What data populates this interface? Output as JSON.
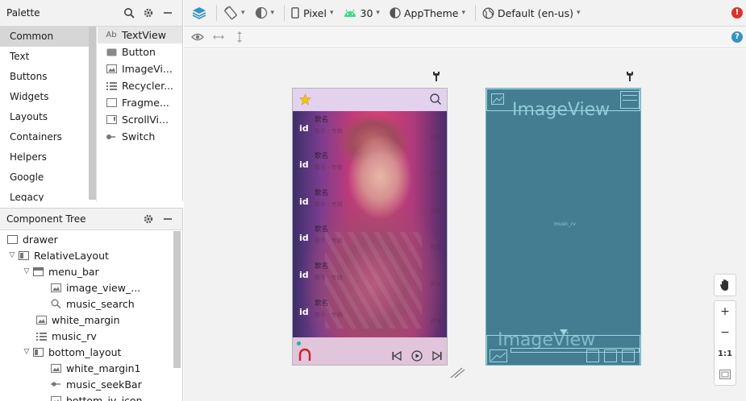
{
  "palette": {
    "title": "Palette",
    "categories": [
      "Common",
      "Text",
      "Buttons",
      "Widgets",
      "Layouts",
      "Containers",
      "Helpers",
      "Google",
      "Legacy"
    ],
    "selected_category": "Common",
    "items": [
      {
        "icon_text": "Ab",
        "label": "TextView",
        "icon": "textview-icon"
      },
      {
        "icon_text": "",
        "label": "Button",
        "icon": "button-icon"
      },
      {
        "icon_text": "",
        "label": "ImageVi...",
        "icon": "image-icon"
      },
      {
        "icon_text": "",
        "label": "Recycler...",
        "icon": "list-icon"
      },
      {
        "icon_text": "",
        "label": "Fragme...",
        "icon": "fragment-icon"
      },
      {
        "icon_text": "",
        "label": "ScrollVi...",
        "icon": "scrollview-icon"
      },
      {
        "icon_text": "",
        "label": "Switch",
        "icon": "switch-icon"
      }
    ]
  },
  "component_tree": {
    "title": "Component Tree",
    "nodes": [
      {
        "label": "drawer",
        "depth": 0,
        "arrow": "",
        "icon": "layout-icon"
      },
      {
        "label": "RelativeLayout",
        "depth": 0,
        "arrow": "v",
        "icon": "relativelayout-icon"
      },
      {
        "label": "menu_bar",
        "depth": 1,
        "arrow": "v",
        "icon": "toolbar-icon"
      },
      {
        "label": "image_view_...",
        "depth": 2,
        "arrow": "",
        "icon": "image-icon"
      },
      {
        "label": "music_search",
        "depth": 2,
        "arrow": "",
        "icon": "search-icon"
      },
      {
        "label": "white_margin",
        "depth": 1,
        "arrow": "",
        "icon": "image-icon"
      },
      {
        "label": "music_rv",
        "depth": 1,
        "arrow": "",
        "icon": "list-icon"
      },
      {
        "label": "bottom_layout",
        "depth": 1,
        "arrow": "v",
        "icon": "relativelayout-icon"
      },
      {
        "label": "white_margin1",
        "depth": 2,
        "arrow": "",
        "icon": "image-icon"
      },
      {
        "label": "music_seekBar",
        "depth": 2,
        "arrow": "",
        "icon": "seekbar-icon"
      },
      {
        "label": "bottom_iv_icon",
        "depth": 2,
        "arrow": "",
        "icon": "image-icon"
      }
    ]
  },
  "toolbar": {
    "device": "Pixel",
    "api": "30",
    "theme": "AppTheme",
    "locale": "Default (en-us)"
  },
  "design": {
    "rows": [
      {
        "id": "id",
        "name": "歌名",
        "sub": "歌手 · 专辑",
        "time": "时长"
      },
      {
        "id": "id",
        "name": "歌名",
        "sub": "歌手 · 专辑",
        "time": "时长"
      },
      {
        "id": "id",
        "name": "歌名",
        "sub": "歌手 · 专辑",
        "time": "时长"
      },
      {
        "id": "id",
        "name": "歌名",
        "sub": "歌手 · 专辑",
        "time": "时长"
      },
      {
        "id": "id",
        "name": "歌名",
        "sub": "歌手 · 专辑",
        "time": "时长"
      },
      {
        "id": "id",
        "name": "歌名",
        "sub": "歌手 · 专辑",
        "time": "时长"
      }
    ]
  },
  "blueprint": {
    "image_view_label": "ImageView",
    "music_rv_label": "music_rv",
    "bottom_label": "ImageView"
  },
  "zoom": {
    "zoom_in": "+",
    "zoom_out": "−",
    "actual_size": "1:1"
  },
  "colors": {
    "menu_bar": "#e2d2ee",
    "blueprint_bg": "#447d91",
    "accent_blue": "#3592c4",
    "error_red": "#d9342b"
  }
}
